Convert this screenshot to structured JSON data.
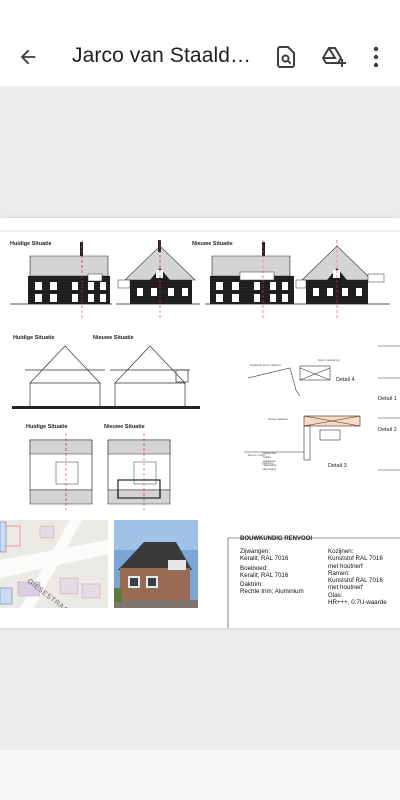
{
  "appbar": {
    "title": "Jarco van Staalduijn Bouwkundig Tekenaar",
    "back_icon": "arrow-back-icon",
    "find_icon": "find-in-page-icon",
    "drive_icon": "add-to-drive-icon",
    "more_icon": "more-vert-icon"
  },
  "drawing": {
    "elevations": {
      "left_label_1": "Huidige Situatie",
      "left_label_2": "Nieuwe Situatie",
      "right_label": "Nieuwe Situatie"
    },
    "sections": {
      "label_1": "Huidige Situatie",
      "label_2": "Nieuwe Situatie"
    },
    "plans": {
      "label_1": "Huidige Situatie",
      "label_2": "Nieuwe Situatie"
    },
    "details": {
      "detail_4": "Detail 4",
      "detail_1": "Detail 1",
      "detail_2": "Detail 2",
      "detail_3": "Detail 3"
    },
    "map": {
      "street": "GIESESTRAAT"
    },
    "renvooi": {
      "title": "BOUWKUNDIG RENVOOI",
      "col1": [
        "Zijwangen:",
        "Keralit; RAL 7016",
        "",
        "Boeiboed:",
        "Keralit; RAL 7016",
        "",
        "Daktrim:",
        "Rechte trim; Aluminium"
      ],
      "col2": [
        "Kozijnen:",
        "Kunststof RAL 7016",
        "met houtnerf",
        "Ramen:",
        "Kunststof RAL 7016",
        "met houtnerf",
        "Glas:",
        "HR+++, 0.7U-waarde"
      ]
    }
  }
}
